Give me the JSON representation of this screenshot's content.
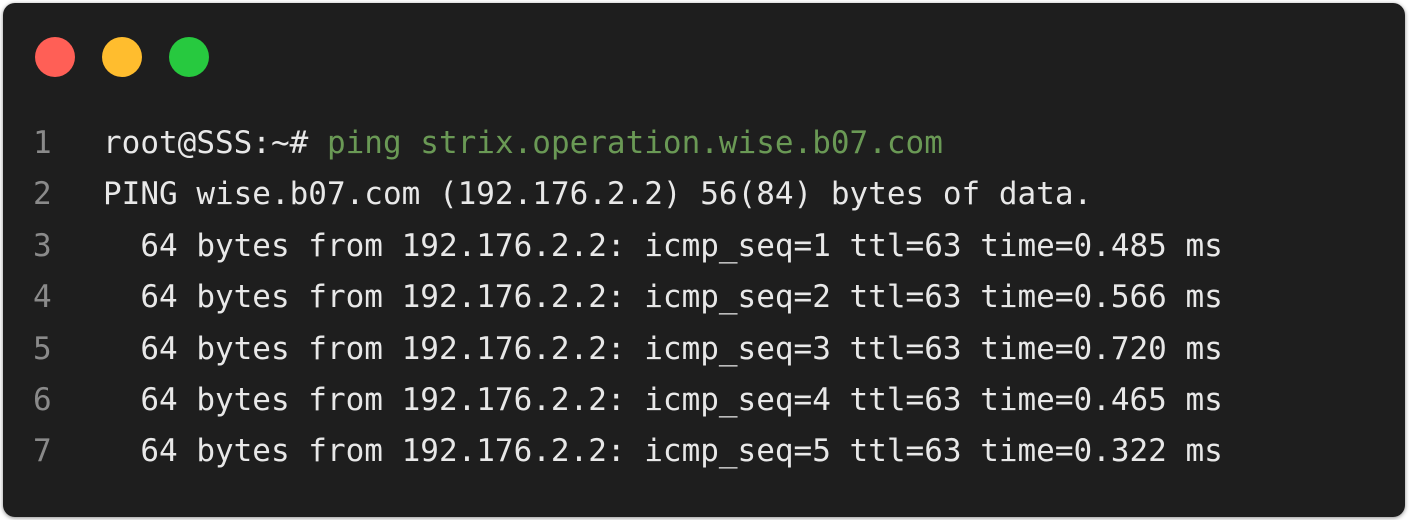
{
  "window_controls": {
    "close_color": "#ff5f56",
    "minimize_color": "#ffbd2e",
    "maximize_color": "#27c93f"
  },
  "terminal": {
    "line1": {
      "number": "1",
      "prompt": "root@SSS:~#",
      "command": " ping strix.operation.wise.b07.com"
    },
    "lines": [
      {
        "number": "2",
        "text": "PING wise.b07.com (192.176.2.2) 56(84) bytes of data."
      },
      {
        "number": "3",
        "text": "  64 bytes from 192.176.2.2: icmp_seq=1 ttl=63 time=0.485 ms"
      },
      {
        "number": "4",
        "text": "  64 bytes from 192.176.2.2: icmp_seq=2 ttl=63 time=0.566 ms"
      },
      {
        "number": "5",
        "text": "  64 bytes from 192.176.2.2: icmp_seq=3 ttl=63 time=0.720 ms"
      },
      {
        "number": "6",
        "text": "  64 bytes from 192.176.2.2: icmp_seq=4 ttl=63 time=0.465 ms"
      },
      {
        "number": "7",
        "text": "  64 bytes from 192.176.2.2: icmp_seq=5 ttl=63 time=0.322 ms"
      }
    ]
  }
}
